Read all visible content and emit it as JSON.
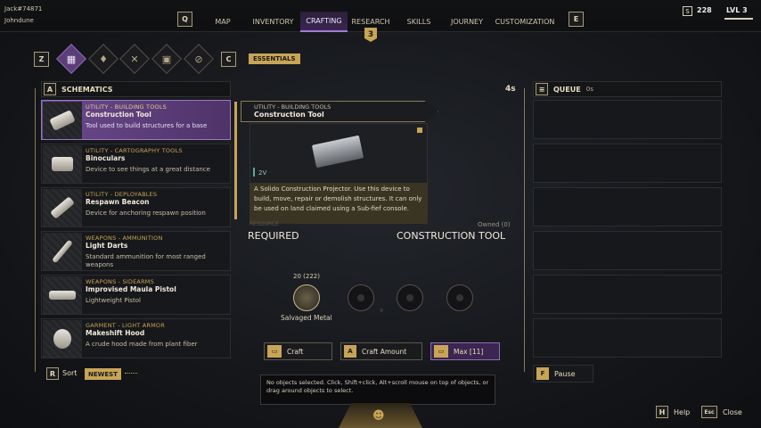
{
  "header": {
    "user_id": "Jack#74871",
    "user_name": "Johndune",
    "left_key": "Q",
    "right_key": "E",
    "tabs": [
      "MAP",
      "INVENTORY",
      "CRAFTING",
      "RESEARCH",
      "SKILLS",
      "JOURNEY",
      "CUSTOMIZATION"
    ],
    "active_tab": "CRAFTING",
    "research_badge": "3",
    "currency_icon": "S",
    "currency": "228",
    "level": "LVL 3"
  },
  "categories": {
    "left_key": "Z",
    "right_key": "C",
    "icons": [
      "grid-icon",
      "droplet-icon",
      "crossed-tools-icon",
      "structures-icon",
      "no-entry-icon"
    ],
    "active_label": "ESSENTIALS"
  },
  "schematics": {
    "key": "A",
    "title": "SCHEMATICS",
    "items": [
      {
        "category": "UTILITY - BUILDING TOOLS",
        "name": "Construction Tool",
        "desc": "Tool used to build structures for a base"
      },
      {
        "category": "UTILITY - CARTOGRAPHY TOOLS",
        "name": "Binoculars",
        "desc": "Device to see things at a great distance"
      },
      {
        "category": "UTILITY - DEPLOYABLES",
        "name": "Respawn Beacon",
        "desc": "Device for anchoring respawn position"
      },
      {
        "category": "WEAPONS - AMMUNITION",
        "name": "Light Darts",
        "desc": "Standard ammunition for most ranged weapons"
      },
      {
        "category": "WEAPONS - SIDEARMS",
        "name": "Improvised Maula Pistol",
        "desc": "Lightweight Pistol"
      },
      {
        "category": "GARMENT - LIGHT ARMOR",
        "name": "Makeshift Hood",
        "desc": "A crude hood made from plant fiber"
      }
    ],
    "sort_key": "R",
    "sort_label": "Sort",
    "sort_value": "NEWEST"
  },
  "detail": {
    "category": "UTILITY - BUILDING TOOLS",
    "name": "Construction Tool",
    "voltage": "2V",
    "description": "A Solido Construction Projector. Use this device to build, move, repair or demolish structures. It can only be used on land claimed using a Sub-fief console.",
    "resource_label": "RESOURCE",
    "required_label": "REQUIRED",
    "item_label": "CONSTRUCTION TOOL",
    "owned": "Owned (0)",
    "ingredient_count": "20 (222)",
    "ingredient_name": "Salvaged Metal"
  },
  "actions": {
    "craft": "Craft",
    "craft_amount_key": "A",
    "craft_amount": "Craft Amount",
    "max": "Max [11]"
  },
  "tooltip": "No objects selected. Click, Shift+click, Alt+scroll mouse on top of objects, or drag around objects to select.",
  "queue": {
    "timer": "4s",
    "title": "QUEUE",
    "time": "0s",
    "pause_key": "F",
    "pause": "Pause"
  },
  "footer": {
    "help_key": "H",
    "help": "Help",
    "close_key": "Esc",
    "close": "Close"
  },
  "colors": {
    "accent_gold": "#c8a456",
    "accent_purple": "#6c4a8e"
  }
}
